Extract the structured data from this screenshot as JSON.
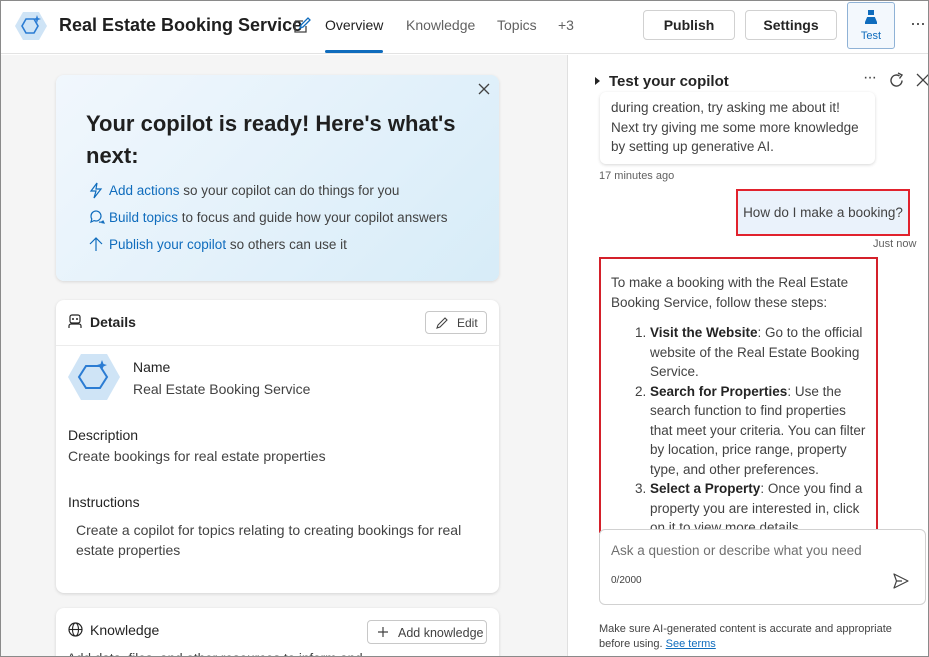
{
  "header": {
    "app_title": "Real Estate Booking Service",
    "tabs": [
      {
        "label": "Overview",
        "active": true
      },
      {
        "label": "Knowledge",
        "active": false
      },
      {
        "label": "Topics",
        "active": false
      },
      {
        "label": "+3",
        "active": false
      }
    ],
    "publish_label": "Publish",
    "settings_label": "Settings",
    "test_label": "Test",
    "more_label": "···"
  },
  "hero": {
    "title": "Your copilot is ready! Here's what's next:",
    "items": [
      {
        "link": "Add actions",
        "text": " so your copilot can do things for you",
        "icon": "lightning-icon"
      },
      {
        "link": "Build topics",
        "text": " to focus and guide how your copilot answers",
        "icon": "chat-bubbles-icon"
      },
      {
        "link": "Publish your copilot",
        "text": " so others can use it",
        "icon": "arrow-up-icon"
      }
    ]
  },
  "details": {
    "header": "Details",
    "edit_label": "Edit",
    "name_label": "Name",
    "name_value": "Real Estate Booking Service",
    "description_label": "Description",
    "description_value": "Create bookings for real estate properties",
    "instructions_label": "Instructions",
    "instructions_value": "Create a copilot for topics relating to creating bookings for real estate properties"
  },
  "knowledge": {
    "header": "Knowledge",
    "add_label": "Add knowledge",
    "description": "Add data, files, and other resources to inform and"
  },
  "chat": {
    "title": "Test your copilot",
    "prev_message": "during creation, try asking me about it! Next try giving me some more knowledge by setting up generative AI.",
    "prev_time": "17 minutes ago",
    "user_message": "How do I make a booking?",
    "user_time": "Just now",
    "answer_intro": "To make a booking with the Real Estate Booking Service, follow these steps:",
    "steps": [
      {
        "title": "Visit the Website",
        "text": ": Go to the official website of the Real Estate Booking Service."
      },
      {
        "title": "Search for Properties",
        "text": ": Use the search function to find properties that meet your criteria. You can filter by location, price range, property type, and other preferences."
      },
      {
        "title": "Select a Property",
        "text": ": Once you find a property you are interested in, click on it to view more details."
      }
    ],
    "input_placeholder": "Ask a question or describe what you need",
    "counter": "0/2000",
    "disclaimer": "Make sure AI-generated content is accurate and appropriate before using. ",
    "disclaimer_link": "See terms"
  },
  "colors": {
    "accent": "#0f6cbd",
    "highlight_border": "#e1222d",
    "hero_bg": "#d7ecf8"
  }
}
